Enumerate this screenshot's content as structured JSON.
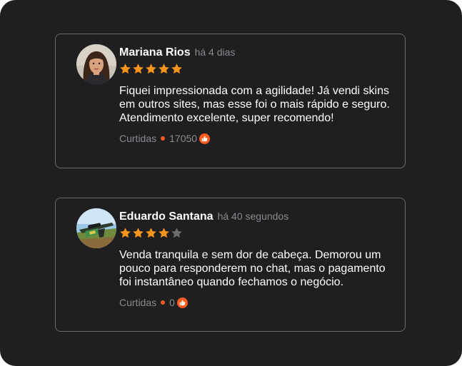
{
  "reviews": [
    {
      "name": "Mariana Rios",
      "time": "há 4 dias",
      "rating": 5,
      "text": "Fiquei impressionada com a agilidade! Já vendi skins em outros sites, mas esse foi o mais rápido e seguro. Atendimento excelente, super recomendo!",
      "likes_label": "Curtidas",
      "likes": "17050",
      "avatar": "woman-portrait-avatar"
    },
    {
      "name": "Eduardo Santana",
      "time": "há 40 segundos",
      "rating": 4,
      "text": "Venda tranquila e sem dor de cabeça. Demorou um pouco para responderem no chat, mas o pagamento foi instantâneo quando fechamos o negócio.",
      "likes_label": "Curtidas",
      "likes": "0",
      "avatar": "sniper-rifle-skin-avatar"
    }
  ],
  "colors": {
    "background": "#1f1f21",
    "border": "#6a6a6e",
    "star_filled": "#f7941d",
    "star_empty": "#6d6d70",
    "accent": "#ff5a1f",
    "muted": "#8b8b8f"
  }
}
